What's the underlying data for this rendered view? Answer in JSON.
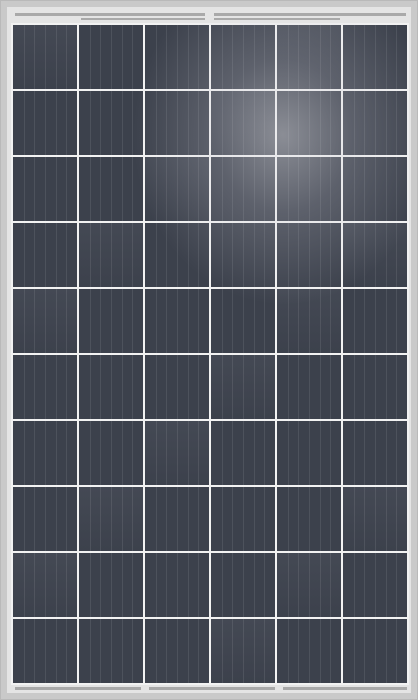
{
  "panel": {
    "description_name": "polycrystalline-solar-panel",
    "columns": 6,
    "rows": 10,
    "fingers_per_cell": 5,
    "colors": {
      "frame": "#c9c9c9",
      "frame_inner": "#e4e4e4",
      "grid_lines": "#f2f2f2",
      "cell_dark": "#3c414c",
      "cell_mid": "#444954",
      "busbar": "#a9a9a9"
    }
  }
}
